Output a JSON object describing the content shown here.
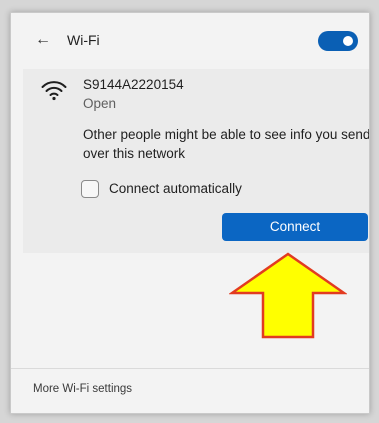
{
  "header": {
    "back_icon": "back-arrow-icon",
    "back_glyph": "←",
    "title": "Wi-Fi",
    "toggle_state": "on",
    "accent_color": "#0a5fb4"
  },
  "network": {
    "icon": "wifi-icon",
    "ssid": "S9144A2220154",
    "security": "Open",
    "warning": "Other people might be able to see info you send over this network",
    "connect_automatically": {
      "label": "Connect automatically",
      "checked": false
    },
    "connect_button": "Connect",
    "button_color": "#0b66c3"
  },
  "annotation": {
    "icon": "up-arrow-annotation",
    "fill_color": "#ffff00",
    "stroke_color": "#e23b20"
  },
  "footer": {
    "link": "More Wi-Fi settings"
  }
}
